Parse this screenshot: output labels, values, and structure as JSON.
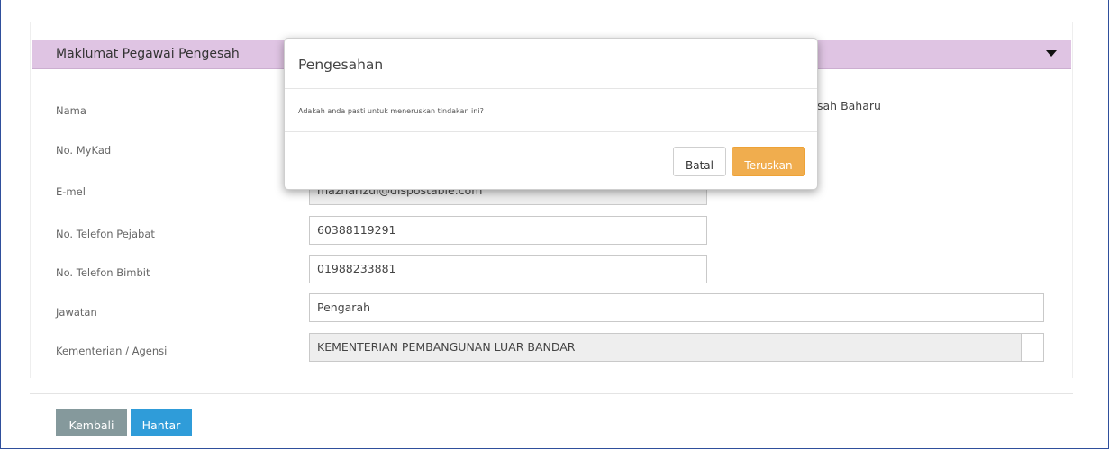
{
  "section": {
    "title": "Maklumat Pegawai Pengesah"
  },
  "form": {
    "fields": [
      {
        "label": "Nama",
        "value": ""
      },
      {
        "label": "No. MyKad",
        "value": ""
      },
      {
        "label": "E-mel",
        "value": "mazharizul@dispostable.com"
      },
      {
        "label": "No. Telefon Pejabat",
        "value": "60388119291"
      },
      {
        "label": "No. Telefon Bimbit",
        "value": "01988233881"
      },
      {
        "label": "Jawatan",
        "value": "Pengarah"
      },
      {
        "label": "Kementerian / Agensi",
        "value": "KEMENTERIAN PEMBANGUNAN LUAR BANDAR"
      }
    ],
    "partial_behind_text": "sah Baharu"
  },
  "actions": {
    "back_label": "Kembali",
    "submit_label": "Hantar"
  },
  "modal": {
    "title": "Pengesahan",
    "message": "Adakah anda pasti untuk meneruskan tindakan ini?",
    "cancel_label": "Batal",
    "confirm_label": "Teruskan"
  },
  "colors": {
    "header_bg": "#dfc4e3",
    "confirm_button": "#f0ad4e",
    "submit_button": "#2f9cd9",
    "back_button": "#85999c"
  }
}
